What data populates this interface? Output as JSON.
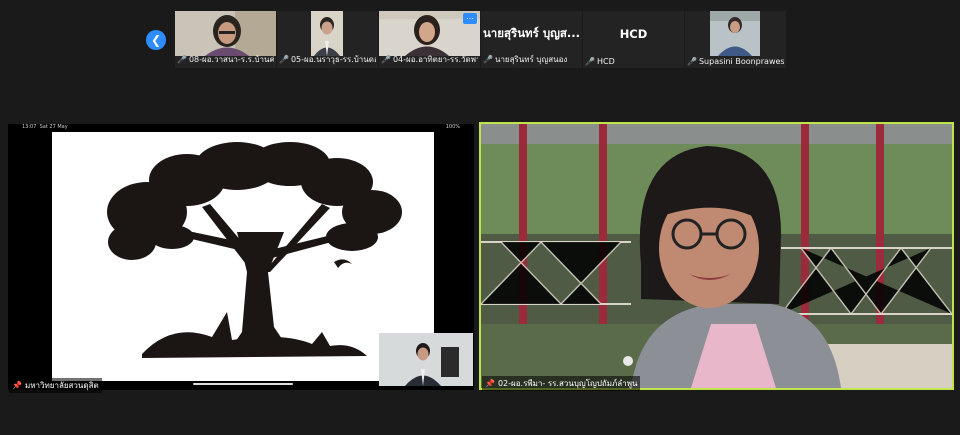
{
  "participants": [
    {
      "name": "08-ผอ.วาสนา-ร.ร.บ้านค่าย...",
      "kind": "video"
    },
    {
      "name": "05-ผอ.นราวุธ-รร.บ้านดอ...",
      "kind": "video"
    },
    {
      "name": "04-ผอ.อาทิตยา-รร.วัดพวง",
      "kind": "video"
    },
    {
      "name": "นายสุรินทร์ บุญสนอง",
      "display": "นายสุรินทร์ บุญส...",
      "kind": "name"
    },
    {
      "name": "HCD",
      "display": "HCD",
      "kind": "name"
    },
    {
      "name": "Supasini Boonprawes",
      "kind": "video"
    }
  ],
  "icons": {
    "prev": "chevron-left-icon",
    "mic": "mic-off-icon",
    "more": "more-icon",
    "pin": "pin-icon"
  },
  "share": {
    "presenter": "มหาวิทยาลัยสวนดุสิต",
    "ios_time": "13:07",
    "ios_date": "Sat 27 May",
    "ios_battery": "100%"
  },
  "active_speaker": {
    "name": "02-ผอ.รพีมา- รร.สวนบุญโญปถัมภ์ลำพูน"
  },
  "colors": {
    "accent": "#2d8cff",
    "active_border": "#bfe34b",
    "muted": "#e02a2a"
  }
}
